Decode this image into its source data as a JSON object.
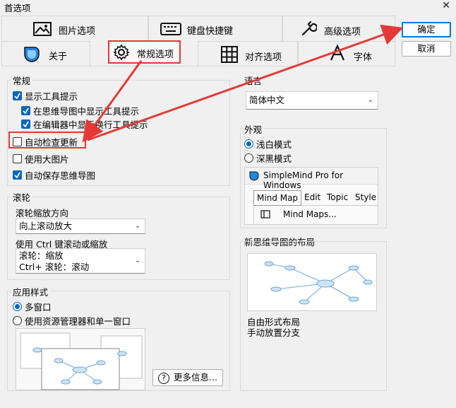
{
  "window": {
    "title": "首选项",
    "close_glyph": "✕"
  },
  "tabs_row1": [
    {
      "label": "图片选项",
      "icon": "image-icon"
    },
    {
      "label": "键盘快捷键",
      "icon": "keyboard-icon"
    },
    {
      "label": "高级选项",
      "icon": "wrench-icon"
    }
  ],
  "tabs_row2": [
    {
      "label": "关于",
      "icon": "simplemind-logo-icon"
    },
    {
      "label": "常规选项",
      "icon": "gear-icon",
      "active": true
    },
    {
      "label": "对齐选项",
      "icon": "grid-icon"
    },
    {
      "label": "字体",
      "icon": "font-icon"
    }
  ],
  "buttons": {
    "ok": "确定",
    "cancel": "取消",
    "more_info": "更多信息..."
  },
  "general": {
    "label": "常规",
    "items": [
      {
        "label": "显示工具提示",
        "checked": true
      },
      {
        "label": "在思维导图中显示工具提示",
        "checked": true
      },
      {
        "label": "在编辑器中显示换行工具提示",
        "checked": true
      },
      {
        "label": "自动检查更新",
        "checked": false
      },
      {
        "label": "使用大图片",
        "checked": false
      },
      {
        "label": "自动保存思维导图",
        "checked": true
      }
    ]
  },
  "scroll": {
    "label": "滚轮",
    "zoom_dir_label": "滚轮缩放方向",
    "zoom_dir_value": "向上滚动放大",
    "ctrl_label": "使用 Ctrl 键滚动或缩放",
    "ctrl_line1": "滚轮：缩放",
    "ctrl_line2": "Ctrl+ 滚轮：滚动"
  },
  "app_style": {
    "label": "应用样式",
    "options": [
      {
        "label": "多窗口",
        "selected": true
      },
      {
        "label": "使用资源管理器和单一窗口",
        "selected": false
      }
    ]
  },
  "language": {
    "label": "语言",
    "value": "简体中文"
  },
  "appearance": {
    "label": "外观",
    "options": [
      {
        "label": "浅白模式",
        "selected": true
      },
      {
        "label": "深黑模式",
        "selected": false
      }
    ],
    "preview_title": "SimpleMind Pro for Windows",
    "preview_menu": [
      "Mind Map",
      "Edit",
      "Topic",
      "Style"
    ],
    "preview_item": "Mind Maps..."
  },
  "layout": {
    "label": "新思维导图的布局",
    "caption1": "自由形式布局",
    "caption2": "手动放置分支"
  },
  "colors": {
    "accent": "#0067c0",
    "highlight": "#e53935",
    "logo": "#1e88e5"
  }
}
